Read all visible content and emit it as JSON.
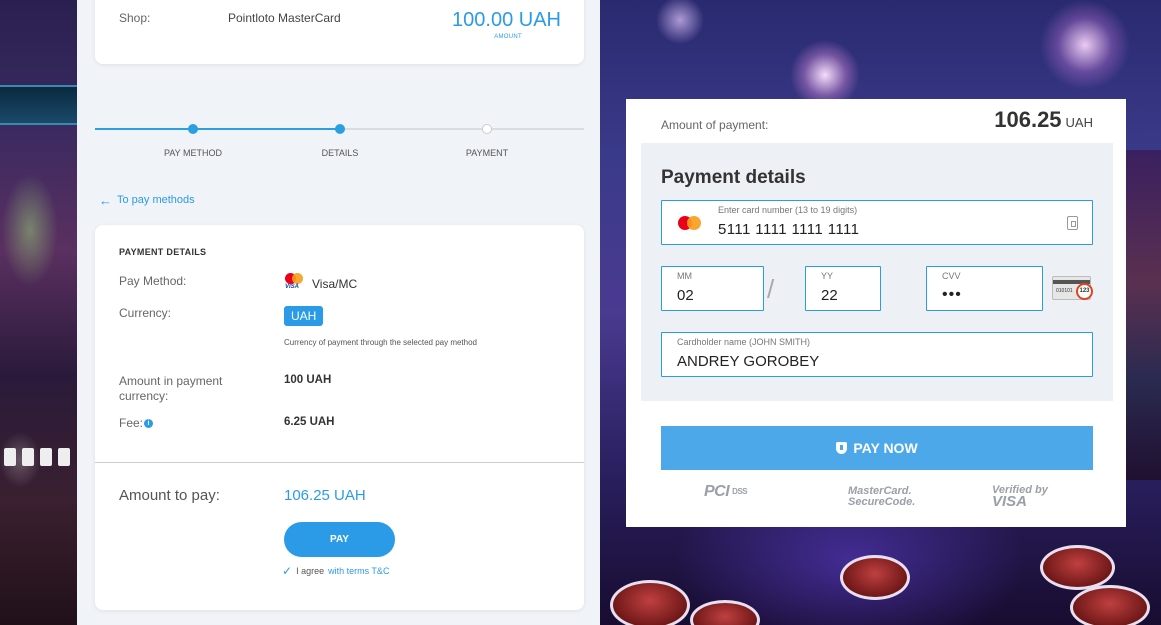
{
  "shop": {
    "label": "Shop:",
    "name": "Pointloto MasterCard",
    "amount": "100.00 UAH",
    "amount_caption": "AMOUNT"
  },
  "stepper": {
    "steps": [
      {
        "label": "PAY METHOD",
        "state": "done"
      },
      {
        "label": "DETAILS",
        "state": "active"
      },
      {
        "label": "PAYMENT",
        "state": "todo"
      }
    ]
  },
  "back_link": {
    "label": "To pay methods"
  },
  "details": {
    "title": "PAYMENT DETAILS",
    "pay_method_label": "Pay Method:",
    "pay_method_value": "Visa/MC",
    "pay_method_icon_text": "VISA",
    "currency_label": "Currency:",
    "currency_value": "UAH",
    "currency_hint": "Currency of payment through the selected pay method",
    "amount_label": "Amount in payment currency:",
    "amount_value": "100 UAH",
    "fee_label": "Fee:",
    "fee_info_icon": "i",
    "fee_value": "6.25 UAH",
    "total_label": "Amount to pay:",
    "total_value": "106.25 UAH",
    "pay_button": "PAY",
    "agree_text": "I agree",
    "terms_link": "with terms T&C"
  },
  "payment_form": {
    "amount_label": "Amount of payment:",
    "amount_value": "106.25",
    "amount_currency": "UAH",
    "title": "Payment details",
    "card_number_caption": "Enter card number (13 to 19 digits)",
    "card_number_value": "5111 1111 1111 1111",
    "mm_caption": "MM",
    "mm_value": "02",
    "yy_caption": "YY",
    "yy_value": "22",
    "date_separator": "/",
    "cvv_caption": "CVV",
    "cvv_value": "•••",
    "cvv_icon_digits": "010101",
    "cvv_icon_code": "123",
    "name_caption": "Cardholder name (JOHN SMITH)",
    "name_value": "ANDREY GOROBEY",
    "pay_now": "PAY NOW",
    "badges": {
      "pci": "PCI",
      "dss": "DSS",
      "mc_line1": "MasterCard.",
      "mc_line2": "SecureCode.",
      "visa_line1": "Verified by",
      "visa_line2": "VISA"
    }
  },
  "colors": {
    "accent": "#2b9be8",
    "pay_now_bg": "#4ca8e8",
    "panel_bg": "#f0f3f8"
  },
  "icons": [
    "arrow-left-icon",
    "mastercard-icon",
    "info-icon",
    "card-scan-icon",
    "cvv-card-icon",
    "shield-icon",
    "check-icon"
  ]
}
